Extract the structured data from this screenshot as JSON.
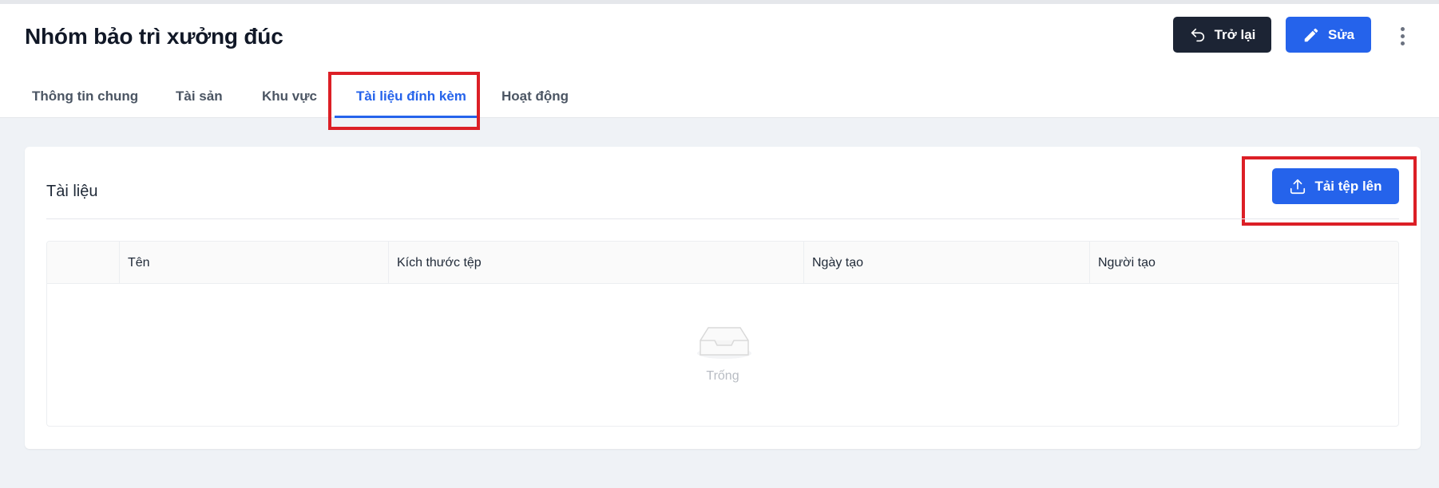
{
  "page": {
    "title": "Nhóm bảo trì xưởng đúc"
  },
  "header": {
    "back_label": "Trở lại",
    "edit_label": "Sửa",
    "more_icon": "more-vertical-icon"
  },
  "tabs": [
    {
      "label": "Thông tin chung",
      "active": false
    },
    {
      "label": "Tài sản",
      "active": false
    },
    {
      "label": "Khu vực",
      "active": false
    },
    {
      "label": "Tài liệu đính kèm",
      "active": true
    },
    {
      "label": "Hoạt động",
      "active": false
    }
  ],
  "documents": {
    "title": "Tài liệu",
    "upload_label": "Tải tệp lên",
    "columns": [
      "",
      "Tên",
      "Kích thước tệp",
      "Ngày tạo",
      "Người tạo"
    ],
    "rows": [],
    "empty_text": "Trống"
  },
  "colors": {
    "primary": "#2563eb",
    "dark": "#1c2434",
    "highlight": "#dc1f26"
  }
}
